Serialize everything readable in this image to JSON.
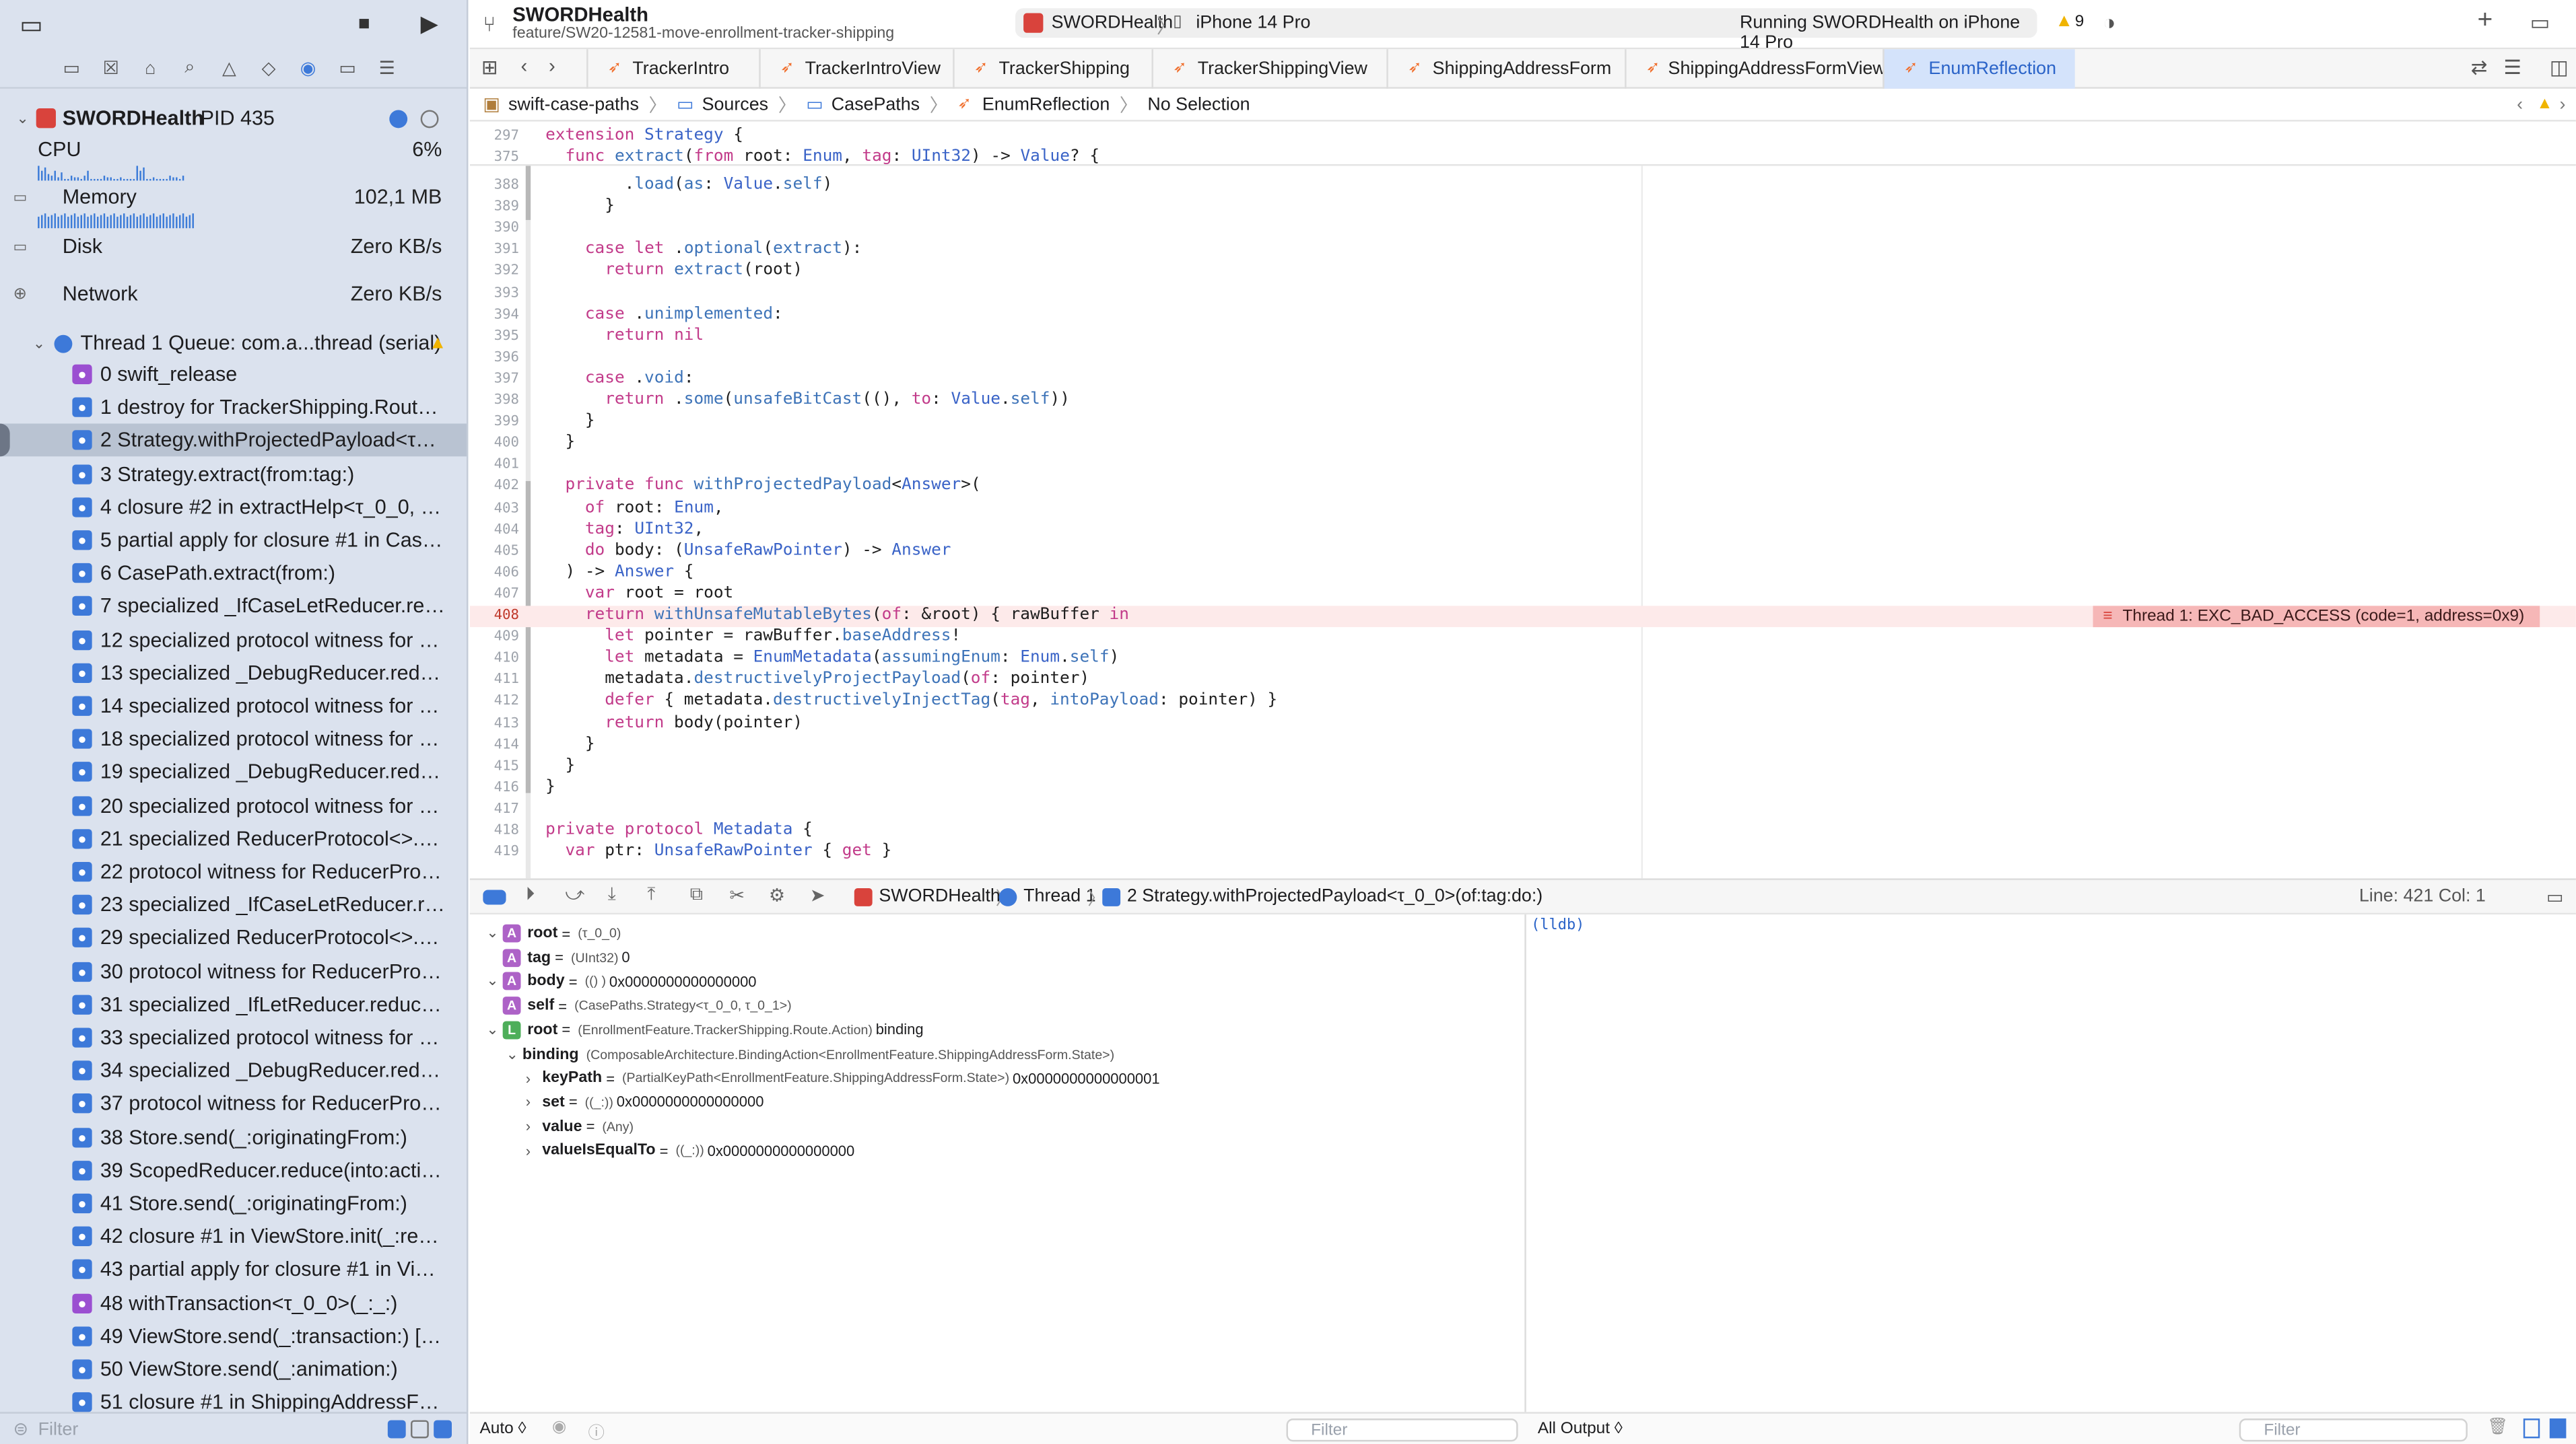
{
  "colors": {
    "sidebar_bg": "#dbe2ee",
    "accent": "#3d79d9",
    "error_bg": "#f6b7b7",
    "warning": "#f0b400"
  },
  "toolbar": {
    "project": "SWORDHealth",
    "branch": "feature/SW20-12581-move-enrollment-tracker-shipping",
    "scheme": "SWORDHealth",
    "device": "iPhone 14 Pro",
    "status": "Running SWORDHealth on iPhone 14 Pro",
    "warnings": "9"
  },
  "tabs": [
    "TrackerIntro",
    "TrackerIntroView",
    "TrackerShipping",
    "TrackerShippingView",
    "ShippingAddressForm",
    "ShippingAddressFormView",
    "EnumReflection"
  ],
  "breadcrumb": [
    "swift-case-paths",
    "Sources",
    "CasePaths",
    "EnumReflection",
    "No Selection"
  ],
  "process": {
    "name": "SWORDHealth",
    "pid": "PID 435"
  },
  "gauges": [
    {
      "label": "CPU",
      "value": "6%"
    },
    {
      "label": "Memory",
      "value": "102,1 MB"
    },
    {
      "label": "Disk",
      "value": "Zero KB/s"
    },
    {
      "label": "Network",
      "value": "Zero KB/s"
    }
  ],
  "thread": {
    "label": "Thread 1 Queue: com.a...thread (serial)"
  },
  "frames": [
    "0 swift_release",
    "1 destroy for TrackerShipping.Route.A...",
    "2 Strategy.withProjectedPayload<τ_0...",
    "3 Strategy.extract(from:tag:)",
    "4 closure #2 in extractHelp<τ_0_0, τ_...",
    "5 partial apply for closure #1 in CaseP...",
    "6 CasePath.extract(from:)",
    "7 specialized _IfCaseLetReducer.redu...",
    "12 specialized protocol witness for Re...",
    "13 specialized _DebugReducer.reduc...",
    "14 specialized protocol witness for Re...",
    "18 specialized protocol witness for Re...",
    "19 specialized _DebugReducer.reduc...",
    "20 specialized protocol witness for R...",
    "21 specialized ReducerProtocol<>.re...",
    "22 protocol witness for ReducerProto...",
    "23 specialized _IfCaseLetReducer.red...",
    "29 specialized ReducerProtocol<>.re...",
    "30 protocol witness for ReducerProto...",
    "31 specialized _IfLetReducer.reduceC...",
    "33 specialized protocol witness for R...",
    "34 specialized _DebugReducer.reduc...",
    "37 protocol witness for ReducerProto...",
    "38 Store.send(_:originatingFrom:)",
    "39 ScopedReducer.reduce(into:action:)",
    "41 Store.send(_:originatingFrom:)",
    "42 closure #1 in ViewStore.init(_:rem...",
    "43 partial apply for closure #1 in View...",
    "48 withTransaction<τ_0_0>(_:_:)",
    "49 ViewStore.send(_:transaction:) [in...",
    "50 ViewStore.send(_:animation:)",
    "51 closure #1 in ShippingAddressFor..."
  ],
  "sidebar_filter": "Filter",
  "code": {
    "sticky": [
      {
        "n": "297",
        "t": "extension Strategy {"
      },
      {
        "n": "375",
        "t": "  func extract(from root: Enum, tag: UInt32) -> Value? {"
      }
    ],
    "lines": [
      {
        "n": "388",
        "t": "        .load(as: Value.self)"
      },
      {
        "n": "389",
        "t": "      }"
      },
      {
        "n": "390",
        "t": ""
      },
      {
        "n": "391",
        "t": "    case let .optional(extract):"
      },
      {
        "n": "392",
        "t": "      return extract(root)"
      },
      {
        "n": "393",
        "t": ""
      },
      {
        "n": "394",
        "t": "    case .unimplemented:"
      },
      {
        "n": "395",
        "t": "      return nil"
      },
      {
        "n": "396",
        "t": ""
      },
      {
        "n": "397",
        "t": "    case .void:"
      },
      {
        "n": "398",
        "t": "      return .some(unsafeBitCast((), to: Value.self))"
      },
      {
        "n": "399",
        "t": "    }"
      },
      {
        "n": "400",
        "t": "  }"
      },
      {
        "n": "401",
        "t": ""
      },
      {
        "n": "402",
        "t": "  private func withProjectedPayload<Answer>("
      },
      {
        "n": "403",
        "t": "    of root: Enum,"
      },
      {
        "n": "404",
        "t": "    tag: UInt32,"
      },
      {
        "n": "405",
        "t": "    do body: (UnsafeRawPointer) -> Answer"
      },
      {
        "n": "406",
        "t": "  ) -> Answer {"
      },
      {
        "n": "407",
        "t": "    var root = root"
      },
      {
        "n": "408",
        "t": "    return withUnsafeMutableBytes(of: &root) { rawBuffer in"
      },
      {
        "n": "409",
        "t": "      let pointer = rawBuffer.baseAddress!"
      },
      {
        "n": "410",
        "t": "      let metadata = EnumMetadata(assumingEnum: Enum.self)"
      },
      {
        "n": "411",
        "t": "      metadata.destructivelyProjectPayload(of: pointer)"
      },
      {
        "n": "412",
        "t": "      defer { metadata.destructivelyInjectTag(tag, intoPayload: pointer) }"
      },
      {
        "n": "413",
        "t": "      return body(pointer)"
      },
      {
        "n": "414",
        "t": "    }"
      },
      {
        "n": "415",
        "t": "  }"
      },
      {
        "n": "416",
        "t": "}"
      },
      {
        "n": "417",
        "t": ""
      },
      {
        "n": "418",
        "t": "private protocol Metadata {"
      },
      {
        "n": "419",
        "t": "  var ptr: UnsafeRawPointer { get }"
      }
    ]
  },
  "error": {
    "line": "408",
    "text": "Thread 1: EXC_BAD_ACCESS (code=1, address=0x9)"
  },
  "debugbar": {
    "app": "SWORDHealth",
    "thread": "Thread 1",
    "frame": "2 Strategy.withProjectedPayload<τ_0_0>(of:tag:do:)",
    "position": "Line: 421  Col: 1"
  },
  "variables": [
    {
      "badge": "A",
      "name": "root",
      "type": "(τ_0_0)",
      "value": ""
    },
    {
      "badge": "A",
      "name": "tag",
      "type": "(UInt32)",
      "value": "0"
    },
    {
      "badge": "A",
      "name": "body",
      "type": "(() )",
      "value": "0x0000000000000000"
    },
    {
      "badge": "A",
      "name": "self",
      "type": "(CasePaths.Strategy<τ_0_0, τ_0_1>)",
      "value": ""
    },
    {
      "badge": "L",
      "name": "root",
      "type": "(EnrollmentFeature.TrackerShipping.Route.Action)",
      "value": "binding"
    },
    {
      "badge": "",
      "name": "binding",
      "type": "(ComposableArchitecture.BindingAction<EnrollmentFeature.ShippingAddressForm.State>)",
      "value": ""
    },
    {
      "badge": "",
      "name": "keyPath",
      "type": "(PartialKeyPath<EnrollmentFeature.ShippingAddressForm.State>)",
      "value": "0x0000000000000001"
    },
    {
      "badge": "",
      "name": "set",
      "type": "((_:))",
      "value": "0x0000000000000000"
    },
    {
      "badge": "",
      "name": "value",
      "type": "(Any)",
      "value": ""
    },
    {
      "badge": "",
      "name": "valueIsEqualTo",
      "type": "((_:))",
      "value": "0x0000000000000000"
    }
  ],
  "console": {
    "prompt": "(lldb)"
  },
  "bottom": {
    "auto": "Auto ◊",
    "filter": "Filter",
    "output": "All Output ◊",
    "filter2": "Filter"
  }
}
